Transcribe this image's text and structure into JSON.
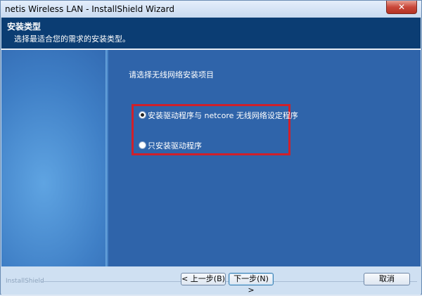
{
  "window": {
    "title": "netis Wireless LAN - InstallShield Wizard",
    "close_glyph": "✕"
  },
  "header": {
    "title": "安装类型",
    "subtitle": "选择最适合您的需求的安装类型。"
  },
  "content": {
    "prompt": "请选择无线网络安装项目",
    "options": [
      {
        "label": "安装驱动程序与 netcore 无线网络设定程序",
        "selected": true
      },
      {
        "label": "只安装驱动程序",
        "selected": false
      }
    ]
  },
  "footer": {
    "brand": "InstallShield",
    "back_label": "< 上一步(B)",
    "next_label": "下一步(N) >",
    "cancel_label": "取消"
  }
}
